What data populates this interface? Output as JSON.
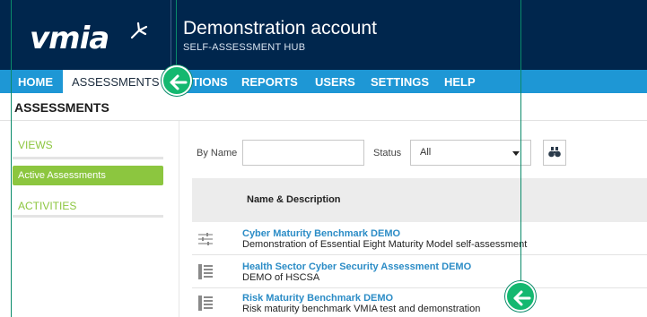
{
  "header": {
    "logo_text": "vmia",
    "account_title": "Demonstration account",
    "account_subtitle": "SELF-ASSESSMENT HUB"
  },
  "nav": {
    "home": "HOME",
    "assessments": "ASSESSMENTS",
    "actions_partial": "TIONS",
    "reports": "REPORTS",
    "users": "USERS",
    "settings": "SETTINGS",
    "help": "HELP"
  },
  "page": {
    "title": "ASSESSMENTS"
  },
  "sidebar": {
    "views_header": "VIEWS",
    "active_item": "Active Assessments",
    "activities_header": "ACTIVITIES"
  },
  "filters": {
    "by_name_label": "By Name",
    "name_value": "",
    "status_label": "Status",
    "status_value": "All"
  },
  "table": {
    "column_header": "Name & Description",
    "rows": [
      {
        "icon": "sliders-icon",
        "title": "Cyber Maturity Benchmark DEMO",
        "description": "Demonstration of Essential Eight Maturity Model self-assessment"
      },
      {
        "icon": "list-icon",
        "title": "Health Sector Cyber Security Assessment DEMO",
        "description": "DEMO of HSCSA"
      },
      {
        "icon": "list-icon",
        "title": "Risk Maturity Benchmark DEMO",
        "description": "Risk maturity benchmark VMIA test and demonstration"
      }
    ]
  },
  "colors": {
    "header_bg": "#00264d",
    "nav_bg": "#1e97d5",
    "accent_green": "#8cc63f",
    "link_blue": "#2b8cc6",
    "annotation_green": "#14b870"
  }
}
